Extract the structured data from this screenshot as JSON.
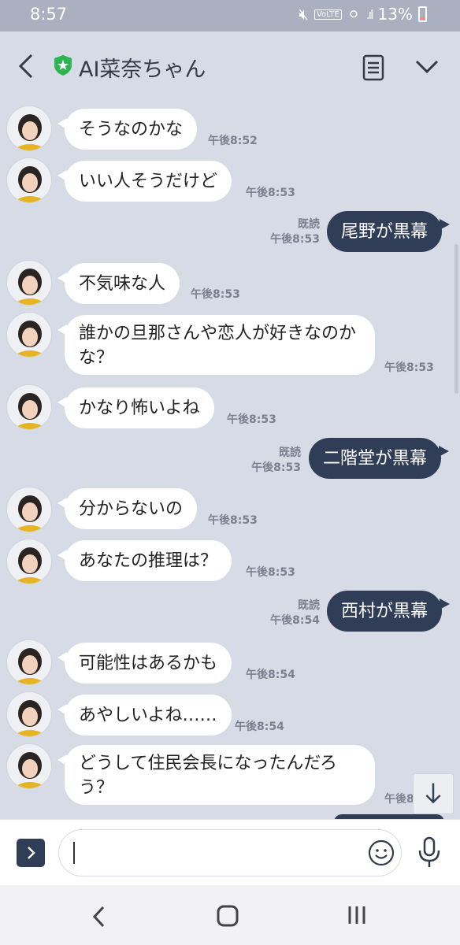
{
  "status": {
    "time": "8:57",
    "volte": "VoLTE",
    "battery": "13%"
  },
  "header": {
    "title": "AI菜奈ちゃん"
  },
  "messages": [
    {
      "text": "そうなのかな",
      "time": "午後8:52"
    },
    {
      "text": "いい人そうだけど",
      "time": "午後8:53"
    },
    {
      "text": "尾野が黒幕",
      "read": "既読",
      "time": "午後8:53"
    },
    {
      "text": "不気味な人",
      "time": "午後8:53"
    },
    {
      "text": "誰かの旦那さんや恋人が好きなのかな？",
      "time": "午後8:53"
    },
    {
      "text": "かなり怖いよね",
      "time": "午後8:53"
    },
    {
      "text": "二階堂が黒幕",
      "read": "既読",
      "time": "午後8:53"
    },
    {
      "text": "分からないの",
      "time": "午後8:53"
    },
    {
      "text": "あなたの推理は？",
      "time": "午後8:53"
    },
    {
      "text": "西村が黒幕",
      "read": "既読",
      "time": "午後8:54"
    },
    {
      "text": "可能性はあるかも",
      "time": "午後8:54"
    },
    {
      "text": "あやしいよね……",
      "time": "午後8:54"
    },
    {
      "text": "どうして住民会長になったんだろう？",
      "time": "午後8:"
    }
  ],
  "colors": {
    "background": "#d7dbe5",
    "sent_bubble": "#2f3d56",
    "received_bubble": "#ffffff",
    "shield": "#2eb352"
  }
}
